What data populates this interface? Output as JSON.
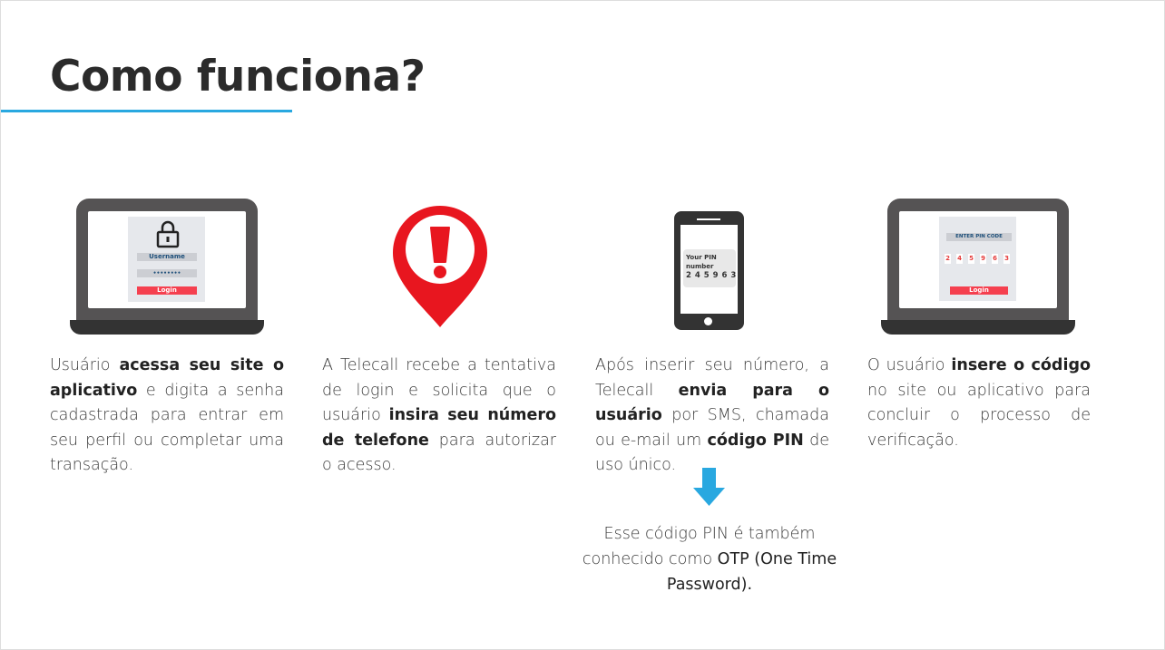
{
  "title": "Como funciona?",
  "colors": {
    "accent": "#29a8e0",
    "alert": "#e8161f",
    "button": "#f5404f"
  },
  "step1": {
    "illustration": {
      "username": "Username",
      "password": "••••••••",
      "login": "Login"
    },
    "text": [
      "Usuário ",
      "acessa seu site o aplicativo",
      " e digita a senha cadastrada para entrar em seu perfil ou completar uma transação."
    ]
  },
  "step2": {
    "icon": "alert-location-pin-icon",
    "text": [
      "A Telecall recebe a tentativa de login e solicita que o usuário ",
      "insira seu número de telefone",
      " para autorizar o acesso."
    ]
  },
  "step3": {
    "illustration": {
      "line1": "Your PIN",
      "line2": "number",
      "pin": "2 4 5 9 6 3"
    },
    "text": [
      "Após inserir seu número, a Telecall ",
      "envia para o usuário",
      " por SMS, chamada ou e-mail um ",
      "código PIN",
      " de uso único."
    ]
  },
  "step4": {
    "illustration": {
      "header": "ENTER PIN CODE",
      "digits": [
        "2",
        "4",
        "5",
        "9",
        "6",
        "3"
      ],
      "login": "Login"
    },
    "text": [
      "O usuário ",
      "insere o código",
      " no site ou aplicativo para concluir o processo de verificação."
    ]
  },
  "note": {
    "icon": "arrow-down-icon",
    "text": [
      "Esse código PIN é também conhecido como ",
      "OTP (One Time Password)."
    ]
  }
}
